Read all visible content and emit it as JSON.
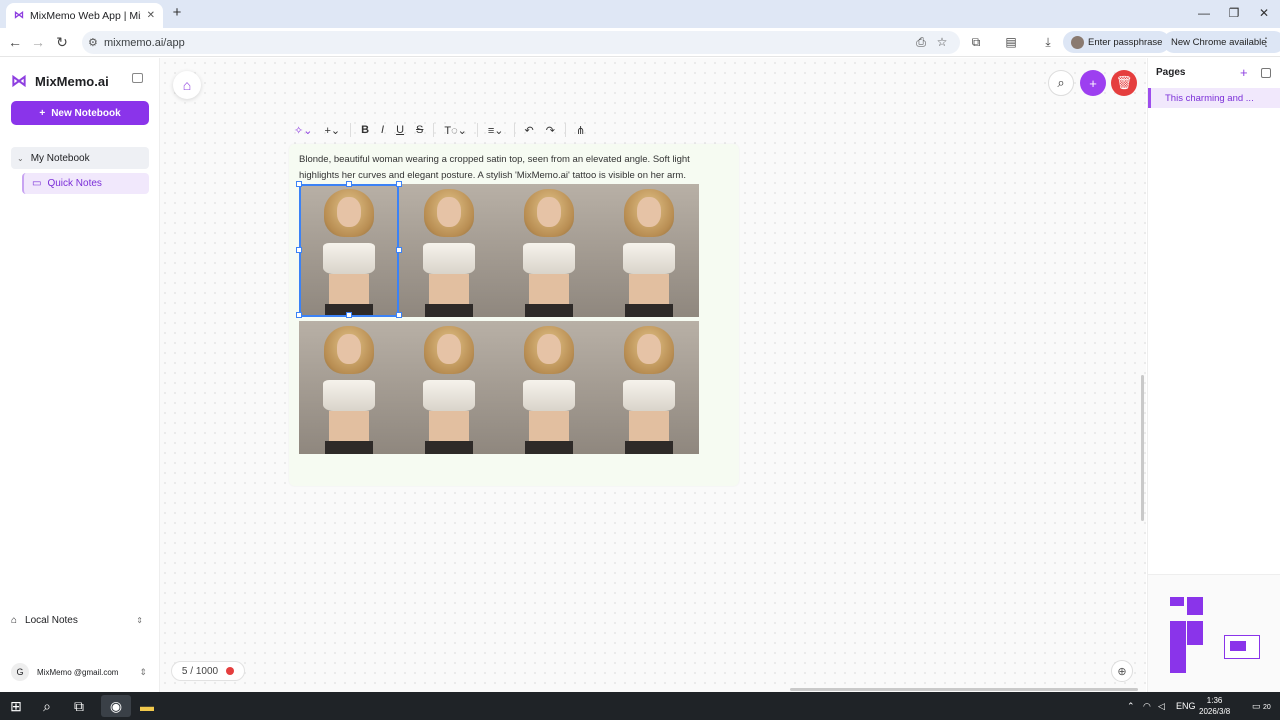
{
  "browser": {
    "tab_title": "MixMemo Web App | MixMe",
    "url": "mixmemo.ai/app",
    "passphrase_label": "Enter passphrase",
    "update_label": "New Chrome available"
  },
  "sidebar": {
    "brand": "MixMemo.ai",
    "new_notebook": "New Notebook",
    "notebook": "My Notebook",
    "quick_notes": "Quick Notes",
    "local_notes": "Local Notes",
    "user_initial": "G",
    "user_email": "MixMemo @gmail.com"
  },
  "editor": {
    "caption": "Blonde, beautiful woman wearing a cropped satin top, seen from an elevated angle. Soft light highlights her curves and elegant posture. A stylish 'MixMemo.ai' tattoo is visible on her arm.",
    "counter": "5 / 1000"
  },
  "pages": {
    "title": "Pages",
    "items": [
      "This charming and ..."
    ]
  },
  "taskbar": {
    "lang": "ENG",
    "time": "1:36",
    "date": "2026/3/8",
    "notif": "20"
  },
  "colors": {
    "accent": "#8a34ea",
    "delete": "#e53e3e",
    "selection": "#3b82f6"
  }
}
